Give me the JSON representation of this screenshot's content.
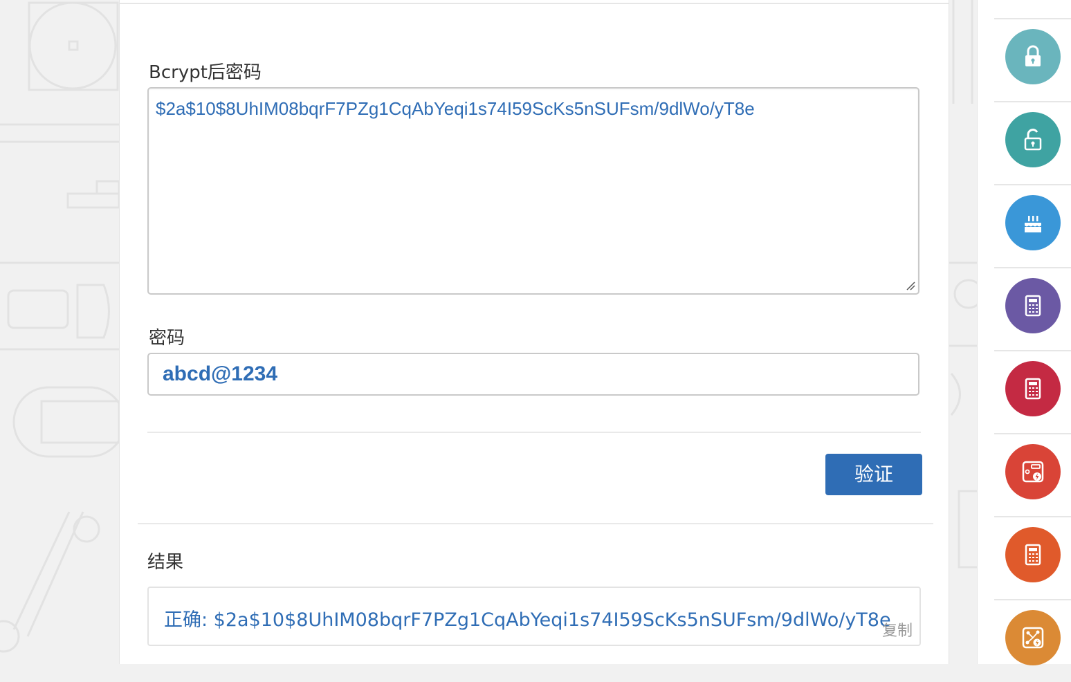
{
  "form": {
    "hash_label": "Bcrypt后密码",
    "hash_value": "$2a$10$8UhIM08bqrF7PZg1CqAbYeqi1s74I59ScKs5nSUFsm/9dlWo/yT8e",
    "password_label": "密码",
    "password_value": "abcd@1234",
    "verify_label": "验证"
  },
  "result": {
    "label": "结果",
    "text": "正确: $2a$10$8UhIM08bqrF7PZg1CqAbYeqi1s74I59ScKs5nSUFsm/9dlWo/yT8e",
    "copy_label": "复制"
  },
  "sidebar": {
    "items": [
      {
        "icon": "lock-icon",
        "color": "#6ab5bd"
      },
      {
        "icon": "unlock-icon",
        "color": "#3fa3a2"
      },
      {
        "icon": "cake-icon",
        "color": "#3a97d8"
      },
      {
        "icon": "calculator-icon",
        "color": "#6b59a4"
      },
      {
        "icon": "calculator-icon",
        "color": "#c42a43"
      },
      {
        "icon": "flash-tool-icon",
        "color": "#d94437"
      },
      {
        "icon": "calculator-icon",
        "color": "#e05a2b"
      },
      {
        "icon": "network-flash-icon",
        "color": "#db8a35"
      }
    ]
  }
}
